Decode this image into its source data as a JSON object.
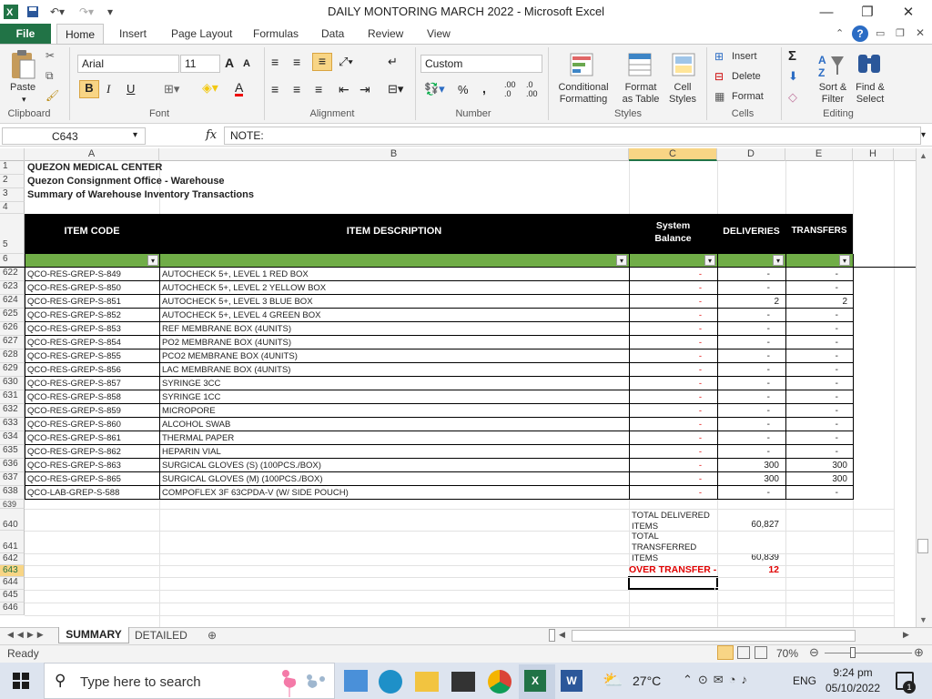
{
  "window": {
    "title": "DAILY MONTORING MARCH 2022  -  Microsoft Excel",
    "minimize": "—",
    "restore": "❐",
    "close": "✕"
  },
  "ribbon_tabs": [
    "File",
    "Home",
    "Insert",
    "Page Layout",
    "Formulas",
    "Data",
    "Review",
    "View"
  ],
  "clipboard": {
    "paste": "Paste",
    "group": "Clipboard"
  },
  "font": {
    "name": "Arial",
    "size": "11",
    "bold": "B",
    "italic": "I",
    "underline": "U",
    "group": "Font",
    "grow": "A",
    "shrink": "A",
    "color_glyph": "A"
  },
  "alignment": {
    "group": "Alignment"
  },
  "number": {
    "format": "Custom",
    "percent": "%",
    "comma": ",",
    "inc": ".00\n.0",
    "dec": ".0\n.00",
    "group": "Number"
  },
  "styles": {
    "conditional": "Conditional\nFormatting",
    "format_table": "Format\nas Table",
    "cell_styles": "Cell\nStyles",
    "group": "Styles"
  },
  "cells": {
    "insert": "Insert",
    "delete": "Delete",
    "format": "Format",
    "group": "Cells"
  },
  "editing": {
    "sum": "Σ",
    "sort": "Sort &\nFilter",
    "find": "Find &\nSelect",
    "group": "Editing"
  },
  "formula_bar": {
    "name_box": "C643",
    "fx": "fx",
    "formula": "NOTE:"
  },
  "columns": [
    "A",
    "B",
    "C",
    "D",
    "E",
    "H"
  ],
  "header_rows": [
    {
      "row": "1",
      "text": "QUEZON MEDICAL CENTER"
    },
    {
      "row": "2",
      "text": "Quezon Consignment Office - Warehouse"
    },
    {
      "row": "3",
      "text": "Summary of Warehouse Inventory Transactions"
    },
    {
      "row": "4",
      "text": ""
    }
  ],
  "table_header": {
    "row": "5",
    "filter_row": "6",
    "item_code": "ITEM CODE",
    "item_description": "ITEM DESCRIPTION",
    "system_balance": "System\nBalance",
    "deliveries": "DELIVERIES",
    "transfers": "TRANSFERS"
  },
  "rows": [
    {
      "row": "622",
      "code": "QCO-RES-GREP-S-849",
      "desc": "AUTOCHECK 5+, LEVEL 1 RED BOX",
      "bal": "-",
      "del": "-",
      "tr": "-"
    },
    {
      "row": "623",
      "code": "QCO-RES-GREP-S-850",
      "desc": "AUTOCHECK 5+, LEVEL 2 YELLOW BOX",
      "bal": "-",
      "del": "-",
      "tr": "-"
    },
    {
      "row": "624",
      "code": "QCO-RES-GREP-S-851",
      "desc": "AUTOCHECK 5+, LEVEL 3 BLUE BOX",
      "bal": "-",
      "del": "2",
      "tr": "2"
    },
    {
      "row": "625",
      "code": "QCO-RES-GREP-S-852",
      "desc": "AUTOCHECK 5+, LEVEL 4 GREEN BOX",
      "bal": "-",
      "del": "-",
      "tr": "-"
    },
    {
      "row": "626",
      "code": "QCO-RES-GREP-S-853",
      "desc": "REF MEMBRANE BOX (4UNITS)",
      "bal": "-",
      "del": "-",
      "tr": "-"
    },
    {
      "row": "627",
      "code": "QCO-RES-GREP-S-854",
      "desc": "PO2 MEMBRANE BOX (4UNITS)",
      "bal": "-",
      "del": "-",
      "tr": "-"
    },
    {
      "row": "628",
      "code": "QCO-RES-GREP-S-855",
      "desc": "PCO2 MEMBRANE BOX (4UNITS)",
      "bal": "-",
      "del": "-",
      "tr": "-"
    },
    {
      "row": "629",
      "code": "QCO-RES-GREP-S-856",
      "desc": "LAC MEMBRANE BOX (4UNITS)",
      "bal": "-",
      "del": "-",
      "tr": "-"
    },
    {
      "row": "630",
      "code": "QCO-RES-GREP-S-857",
      "desc": "SYRINGE 3CC",
      "bal": "-",
      "del": "-",
      "tr": "-"
    },
    {
      "row": "631",
      "code": "QCO-RES-GREP-S-858",
      "desc": "SYRINGE 1CC",
      "bal": "-",
      "del": "-",
      "tr": "-"
    },
    {
      "row": "632",
      "code": "QCO-RES-GREP-S-859",
      "desc": "MICROPORE",
      "bal": "-",
      "del": "-",
      "tr": "-"
    },
    {
      "row": "633",
      "code": "QCO-RES-GREP-S-860",
      "desc": "ALCOHOL SWAB",
      "bal": "-",
      "del": "-",
      "tr": "-"
    },
    {
      "row": "634",
      "code": "QCO-RES-GREP-S-861",
      "desc": "THERMAL PAPER",
      "bal": "-",
      "del": "-",
      "tr": "-"
    },
    {
      "row": "635",
      "code": "QCO-RES-GREP-S-862",
      "desc": "HEPARIN VIAL",
      "bal": "-",
      "del": "-",
      "tr": "-"
    },
    {
      "row": "636",
      "code": "QCO-RES-GREP-S-863",
      "desc": "SURGICAL GLOVES (S) (100PCS./BOX)",
      "bal": "-",
      "del": "300",
      "tr": "300"
    },
    {
      "row": "637",
      "code": "QCO-RES-GREP-S-865",
      "desc": "SURGICAL GLOVES (M) (100PCS./BOX)",
      "bal": "-",
      "del": "300",
      "tr": "300"
    },
    {
      "row": "638",
      "code": "QCO-LAB-GREP-S-588",
      "desc": "COMPOFLEX 3F 63CPDA-V (W/ SIDE POUCH)",
      "bal": "-",
      "del": "-",
      "tr": "-"
    }
  ],
  "summary": {
    "row639": "639",
    "row640": "640",
    "row641": "641",
    "row642": "642",
    "row643": "643",
    "row644": "644",
    "row645": "645",
    "row646": "646",
    "total_delivered_label": "TOTAL DELIVERED\nITEMS",
    "total_delivered": "60,827",
    "total_transferred_label": "TOTAL\nTRANSFERRED\nITEMS",
    "total_transferred": "60,839",
    "over_transfer_label": "OVER TRANSFER -",
    "over_transfer": "12"
  },
  "sheets": [
    "SUMMARY",
    "DETAILED"
  ],
  "status": {
    "ready": "Ready",
    "zoom": "70%"
  },
  "taskbar": {
    "search_placeholder": "Type here to search",
    "weather": "27°C",
    "lang": "ENG",
    "time": "9:24 pm",
    "date": "05/10/2022",
    "notif": "1"
  },
  "colors": {
    "excel_green": "#217346",
    "header_black": "#000000",
    "filter_green": "#70ad47",
    "red": "#e00000"
  }
}
